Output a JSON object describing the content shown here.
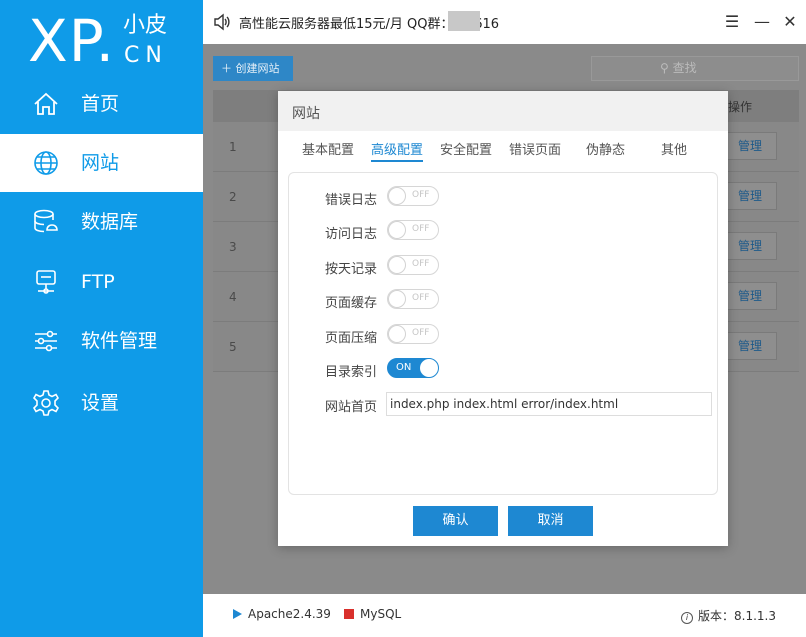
{
  "logo": {
    "brand": "XP.",
    "small": "小皮",
    "domain": "CN"
  },
  "sidebar": {
    "items": [
      {
        "label": "首页",
        "icon": "home-icon"
      },
      {
        "label": "网站",
        "icon": "globe-icon"
      },
      {
        "label": "数据库",
        "icon": "database-icon"
      },
      {
        "label": "FTP",
        "icon": "ftp-server-icon"
      },
      {
        "label": "软件管理",
        "icon": "sliders-icon"
      },
      {
        "label": "设置",
        "icon": "gear-icon"
      }
    ],
    "active": "网站"
  },
  "topbar": {
    "notice": "高性能云服务器最低15元/月  QQ群：1          3616"
  },
  "main": {
    "create_label": "创建网站",
    "search_placeholder": "查找",
    "table_header_op": "操作",
    "rows": [
      {
        "num": "1",
        "action": "管理"
      },
      {
        "num": "2",
        "action": "管理"
      },
      {
        "num": "3",
        "action": "管理"
      },
      {
        "num": "4",
        "action": "管理"
      },
      {
        "num": "5",
        "action": "管理"
      }
    ]
  },
  "modal": {
    "title": "网站",
    "tabs": [
      "基本配置",
      "高级配置",
      "安全配置",
      "错误页面",
      "伪静态",
      "其他"
    ],
    "active_tab": "高级配置",
    "options": [
      {
        "label": "错误日志",
        "state": "OFF"
      },
      {
        "label": "访问日志",
        "state": "OFF"
      },
      {
        "label": "按天记录",
        "state": "OFF"
      },
      {
        "label": "页面缓存",
        "state": "OFF"
      },
      {
        "label": "页面压缩",
        "state": "OFF"
      },
      {
        "label": "目录索引",
        "state": "ON"
      }
    ],
    "homepage_label": "网站首页",
    "homepage_value": "index.php index.html error/index.html",
    "confirm_label": "确认",
    "cancel_label": "取消"
  },
  "status": {
    "apache": "Apache2.4.39",
    "mysql": "MySQL",
    "version": "版本：8.1.1.3"
  },
  "colors": {
    "accent": "#0f9be8",
    "button": "#1e88d2",
    "mysql_stopped": "#d9302c"
  }
}
